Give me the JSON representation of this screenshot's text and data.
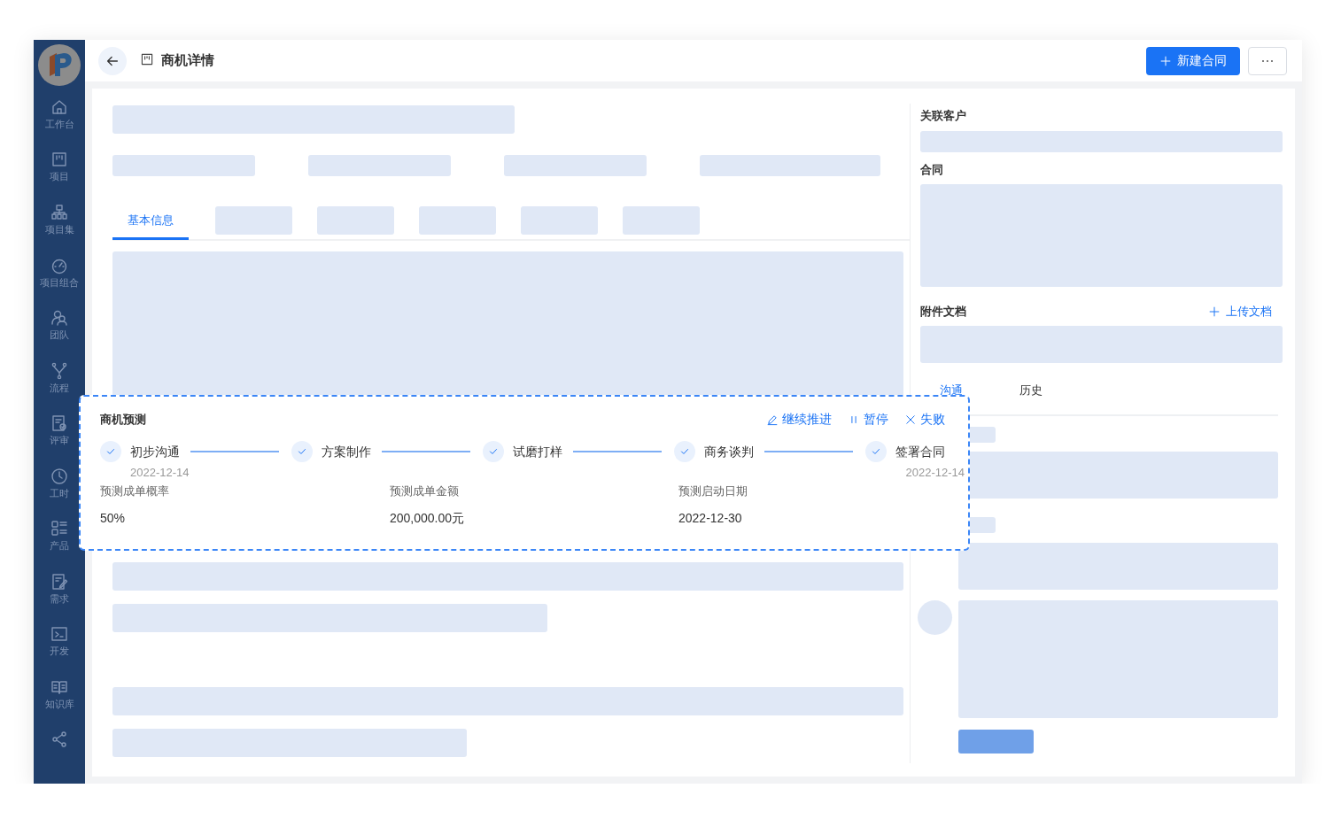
{
  "header": {
    "title": "商机详情",
    "primary_button": "新建合同"
  },
  "sidebar": {
    "items": [
      {
        "kind": "labeled",
        "label": "工作台"
      },
      {
        "kind": "labeled",
        "label": "项目"
      },
      {
        "kind": "labeled",
        "label": "项目集"
      },
      {
        "kind": "labeled",
        "label": "项目组合"
      },
      {
        "kind": "labeled",
        "label": "团队"
      },
      {
        "kind": "labeled",
        "label": "流程"
      },
      {
        "kind": "labeled",
        "label": "评审"
      },
      {
        "kind": "labeled",
        "label": "工时"
      },
      {
        "kind": "labeled",
        "label": "产品"
      },
      {
        "kind": "labeled",
        "label": "需求"
      },
      {
        "kind": "labeled",
        "label": "开发"
      },
      {
        "kind": "labeled",
        "label": "知识库"
      },
      {
        "kind": "icon"
      }
    ]
  },
  "main": {
    "tabs": [
      {
        "label": "基本信息",
        "selected": true
      }
    ]
  },
  "forecast": {
    "title": "商机预测",
    "actions": [
      {
        "kind": "advance",
        "label": "继续推进"
      },
      {
        "kind": "pause",
        "label": "暂停"
      },
      {
        "kind": "fail",
        "label": "失败"
      }
    ],
    "steps": [
      {
        "label": "初步沟通",
        "completed": true,
        "date": "2022-12-14"
      },
      {
        "label": "方案制作",
        "completed": true
      },
      {
        "label": "试磨打样",
        "completed": true
      },
      {
        "label": "商务谈判",
        "completed": true
      },
      {
        "label": "签署合同",
        "completed": true,
        "date": "2022-12-14"
      }
    ],
    "fields": [
      {
        "label": "预测成单概率",
        "value": "50%"
      },
      {
        "label": "预测成单金额",
        "value": "200,000.00元"
      },
      {
        "label": "预测启动日期",
        "value": "2022-12-30"
      }
    ]
  },
  "side": {
    "customer_label": "关联客户",
    "contract_label": "合同",
    "attachments_label": "附件文档",
    "upload_link": "上传文档",
    "tabs": [
      {
        "label": "沟通",
        "selected": true
      },
      {
        "label": "历史",
        "selected": false
      }
    ]
  }
}
